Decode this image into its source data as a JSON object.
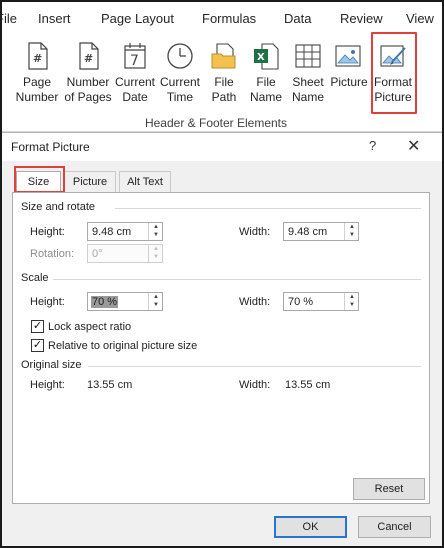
{
  "ribbon": {
    "tabs": [
      "File",
      "Insert",
      "Page Layout",
      "Formulas",
      "Data",
      "Review",
      "View"
    ],
    "buttons": [
      {
        "line1": "Page",
        "line2": "Number",
        "icon": "page-number-icon"
      },
      {
        "line1": "Number",
        "line2": "of Pages",
        "icon": "number-of-pages-icon"
      },
      {
        "line1": "Current",
        "line2": "Date",
        "icon": "calendar-icon"
      },
      {
        "line1": "Current",
        "line2": "Time",
        "icon": "clock-icon"
      },
      {
        "line1": "File",
        "line2": "Path",
        "icon": "folder-icon"
      },
      {
        "line1": "File",
        "line2": "Name",
        "icon": "excel-file-icon"
      },
      {
        "line1": "Sheet",
        "line2": "Name",
        "icon": "sheet-icon"
      },
      {
        "line1": "Picture",
        "line2": "",
        "icon": "picture-icon"
      },
      {
        "line1": "Format",
        "line2": "Picture",
        "icon": "format-picture-icon"
      }
    ],
    "group_label": "Header & Footer Elements",
    "accent": "#e0403a"
  },
  "dialog": {
    "title": "Format Picture",
    "help": "?",
    "close": "✕",
    "tabs": [
      "Size",
      "Picture",
      "Alt Text"
    ],
    "active_tab": "Size",
    "size_rotate": {
      "title": "Size and rotate",
      "height_label": "Height:",
      "height_value": "9.48 cm",
      "width_label": "Width:",
      "width_value": "9.48 cm",
      "rotation_label": "Rotation:",
      "rotation_value": "0°"
    },
    "scale": {
      "title": "Scale",
      "height_label": "Height:",
      "height_value": "70 %",
      "width_label": "Width:",
      "width_value": "70 %",
      "lock_label": "Lock aspect ratio",
      "lock_checked": true,
      "relative_label": "Relative to original picture size",
      "relative_checked": true
    },
    "original": {
      "title": "Original size",
      "height_label": "Height:",
      "height_value": "13.55 cm",
      "width_label": "Width:",
      "width_value": "13.55 cm"
    },
    "reset_label": "Reset",
    "ok_label": "OK",
    "cancel_label": "Cancel"
  }
}
